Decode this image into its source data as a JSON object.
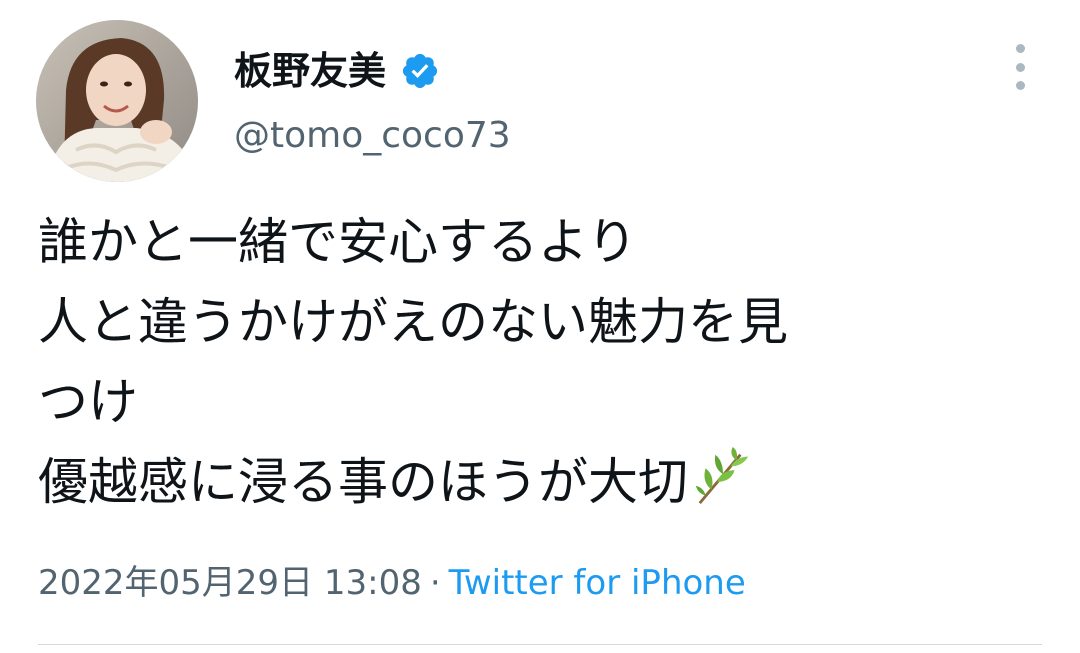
{
  "tweet": {
    "author": {
      "display_name": "板野友美",
      "handle": "@tomo_coco73",
      "verified": true,
      "avatar_icon": "profile-photo"
    },
    "text_lines": [
      "誰かと一緒で安心するより",
      "人と違うかけがえのない魅力を見",
      "つけ",
      "優越感に浸る事のほうが大切"
    ],
    "emoji": "herb-leaf",
    "timestamp": "2022年05月29日 13:08",
    "separator": "·",
    "source": "Twitter for iPhone",
    "more_icon": "more-vertical-icon"
  },
  "colors": {
    "text": "#0f1419",
    "secondary": "#536471",
    "link": "#1d9bf0",
    "verified": "#1d9bf0",
    "divider": "#cfd9de"
  }
}
